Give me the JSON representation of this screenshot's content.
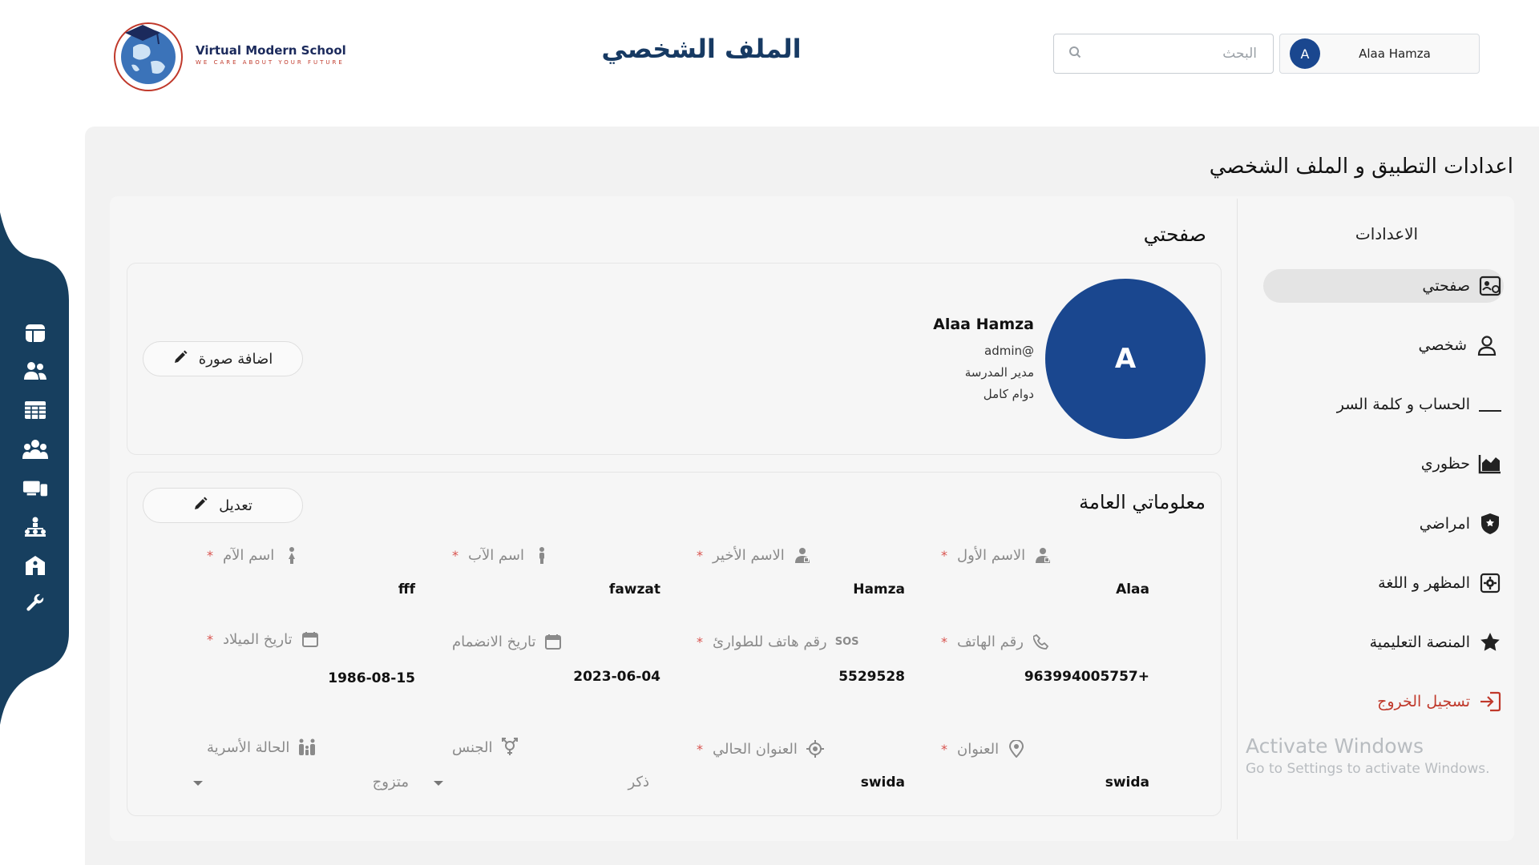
{
  "header": {
    "brand_name": "Virtual Modern School",
    "brand_tagline": "WE CARE ABOUT YOUR FUTURE",
    "page_title": "الملف الشخصي",
    "search_placeholder": "البحث",
    "user_initial": "A",
    "user_name": "Alaa Hamza"
  },
  "left_nav": {
    "color": "#173f5f",
    "items": [
      "dashboard-icon",
      "users-icon",
      "table-icon",
      "groups-icon",
      "devices-icon",
      "hierarchy-icon",
      "school-icon",
      "wrench-icon"
    ]
  },
  "settings_title": "اعدادات التطبيق و الملف الشخصي",
  "menu": {
    "heading": "الاعدادات",
    "items": [
      {
        "label": "صفحتي",
        "icon": "profile-card-icon",
        "active": true
      },
      {
        "label": "شخصي",
        "icon": "person-icon"
      },
      {
        "label": "الحساب و كلمة السر",
        "icon": "password-icon"
      },
      {
        "label": "حظوري",
        "icon": "attendance-chart-icon"
      },
      {
        "label": "امراضي",
        "icon": "health-shield-icon"
      },
      {
        "label": "المظهر و اللغة",
        "icon": "appearance-gear-icon"
      },
      {
        "label": "المنصة التعليمية",
        "icon": "star-icon"
      },
      {
        "label": "تسجيل الخروج",
        "icon": "logout-icon",
        "color": "#c0392b"
      }
    ]
  },
  "watermark": {
    "line1": "Activate Windows",
    "line2": "Go to Settings to activate Windows."
  },
  "profile": {
    "heading": "صفحتي",
    "initial": "A",
    "name": "Alaa Hamza",
    "handle": "@admin",
    "role": "مدير المدرسة",
    "employment": "دوام كامل",
    "add_photo_label": "اضافة صورة"
  },
  "general_info": {
    "heading": "معلوماتي العامة",
    "edit_label": "تعديل",
    "required_mark": "*",
    "fields": {
      "first_name": {
        "label": "الاسم الأول",
        "value": "Alaa"
      },
      "last_name": {
        "label": "الاسم الأخير",
        "value": "Hamza"
      },
      "father_name": {
        "label": "اسم الآب",
        "value": "fawzat"
      },
      "mother_name": {
        "label": "اسم الآم",
        "value": "fff"
      },
      "phone": {
        "label": "رقم الهاتف",
        "value": "963994005757+"
      },
      "emergency_phone": {
        "label": "رقم هاتف للطوارئ",
        "value": "5529528",
        "icon_text": "SOS"
      },
      "join_date": {
        "label": "تاريخ الانضمام",
        "value": "2023-06-04"
      },
      "birth_date": {
        "label": "تاريخ الميلاد",
        "value": "1986-08-15"
      },
      "address": {
        "label": "العنوان",
        "value": "swida"
      },
      "current_address": {
        "label": "العنوان الحالي",
        "value": "swida"
      },
      "gender": {
        "label": "الجنس",
        "value": "ذكر"
      },
      "marital_status": {
        "label": "الحالة الأسرية",
        "value": "متزوج"
      }
    }
  }
}
